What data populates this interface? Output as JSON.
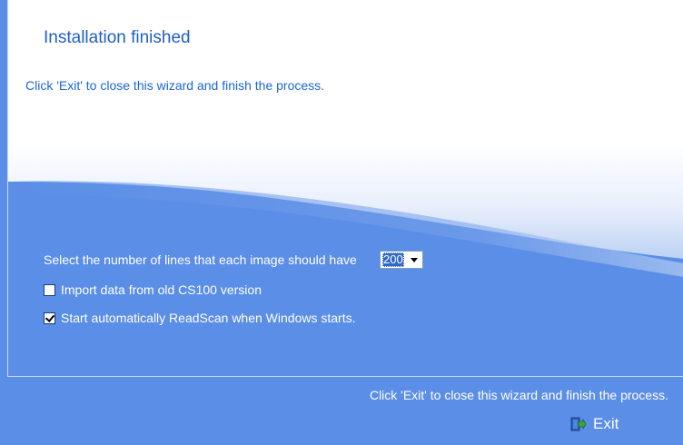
{
  "header": {
    "title": "Installation finished",
    "instruction": "Click 'Exit' to close this wizard and finish the process."
  },
  "options": {
    "lines_label": "Select the number of lines that each image should have",
    "lines_value": "200",
    "checkbox_import": {
      "label": "Import data from old CS100 version",
      "checked": false
    },
    "checkbox_autostart": {
      "label": "Start automatically ReadScan when Windows starts.",
      "checked": true
    }
  },
  "footer": {
    "instruction": "Click 'Exit' to close this wizard and finish the process.",
    "exit_label": "Exit",
    "exit_icon": "exit-door-icon"
  },
  "colors": {
    "background": "#5b8ee6",
    "title": "#1f5fc9",
    "instruction": "#1a67d9"
  }
}
